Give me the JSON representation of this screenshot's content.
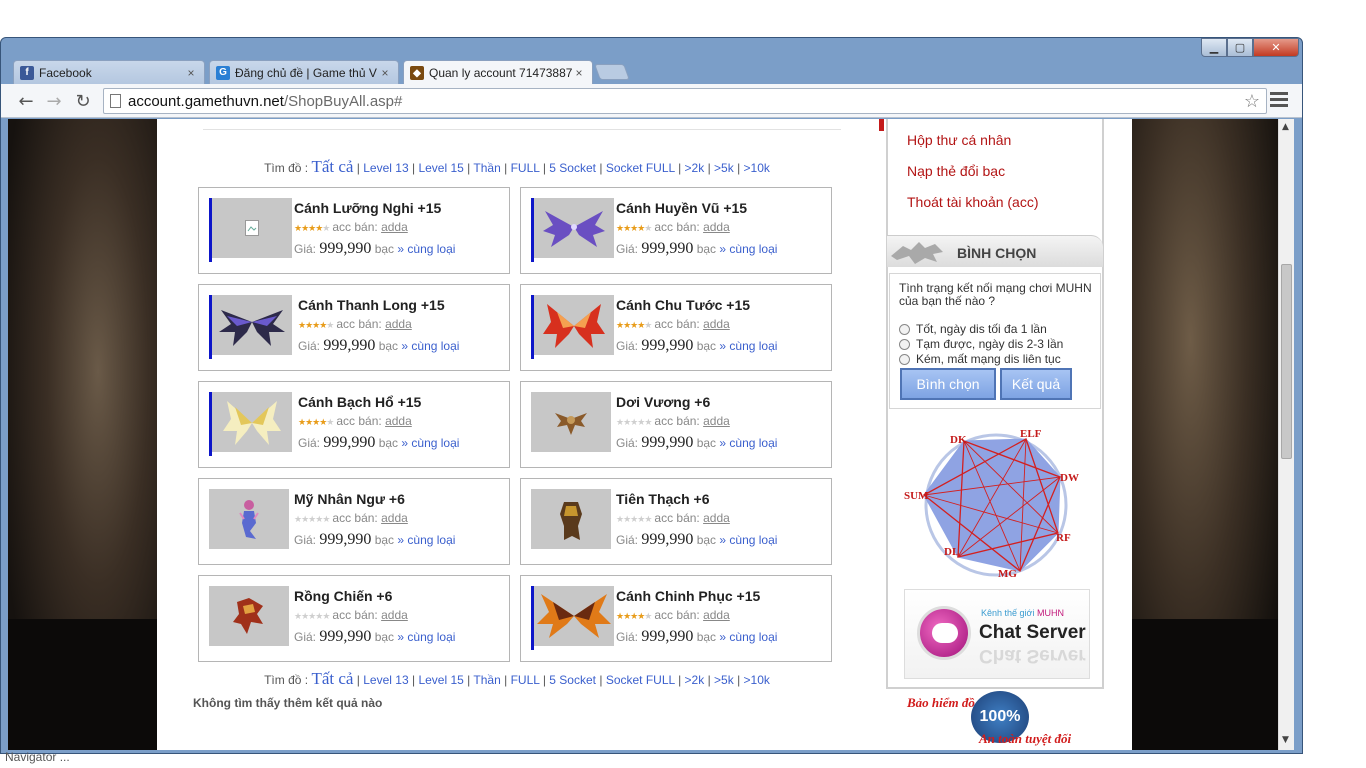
{
  "tabs": [
    {
      "title": "Facebook",
      "favicon": "facebook-icon",
      "close": "×"
    },
    {
      "title": "Đăng chủ đề | Game thủ V",
      "favicon": "gamethu-icon",
      "close": "×"
    },
    {
      "title": "Quan ly account 71473887",
      "favicon": "mu-game-icon",
      "close": "×"
    }
  ],
  "window_controls": {
    "minimize": "▁",
    "maximize": "▢",
    "close": "✕"
  },
  "address": {
    "host": "account.gamethuvn.net",
    "path": "/ShopBuyAll.asp#"
  },
  "filter": {
    "prefix": "Tìm đồ :",
    "all": "Tất cả",
    "links": [
      "Level 13",
      "Level 15",
      "Thần",
      "FULL",
      "5 Socket",
      "Socket FULL",
      ">2k",
      ">5k",
      ">10k"
    ],
    "separator": "|"
  },
  "items": [
    {
      "name": "Cánh Lưỡng Nghi +15",
      "seller_label": "acc bán:",
      "seller": "adda",
      "price_label": "Giá:",
      "price": "999,990",
      "currency": "bạc",
      "same_type": "» cùng loại",
      "rating": 4,
      "icon": "broken-image-icon"
    },
    {
      "name": "Cánh Huyền Vũ +15",
      "seller_label": "acc bán:",
      "seller": "adda",
      "price_label": "Giá:",
      "price": "999,990",
      "currency": "bạc",
      "same_type": "» cùng loại",
      "rating": 4,
      "icon": "purple-wings-icon"
    },
    {
      "name": "Cánh Thanh Long +15",
      "seller_label": "acc bán:",
      "seller": "adda",
      "price_label": "Giá:",
      "price": "999,990",
      "currency": "bạc",
      "same_type": "» cùng loại",
      "rating": 4,
      "icon": "dark-wings-icon"
    },
    {
      "name": "Cánh Chu Tước +15",
      "seller_label": "acc bán:",
      "seller": "adda",
      "price_label": "Giá:",
      "price": "999,990",
      "currency": "bạc",
      "same_type": "» cùng loại",
      "rating": 4,
      "icon": "red-wings-icon"
    },
    {
      "name": "Cánh Bạch Hổ +15",
      "seller_label": "acc bán:",
      "seller": "adda",
      "price_label": "Giá:",
      "price": "999,990",
      "currency": "bạc",
      "same_type": "» cùng loại",
      "rating": 4,
      "icon": "white-wings-icon"
    },
    {
      "name": "Dơi Vương +6",
      "seller_label": "acc bán:",
      "seller": "adda",
      "price_label": "Giá:",
      "price": "999,990",
      "currency": "bạc",
      "same_type": "» cùng loại",
      "rating": 0,
      "icon": "bat-pet-icon"
    },
    {
      "name": "Mỹ Nhân Ngư +6",
      "seller_label": "acc bán:",
      "seller": "adda",
      "price_label": "Giá:",
      "price": "999,990",
      "currency": "bạc",
      "same_type": "» cùng loại",
      "rating": 0,
      "icon": "mermaid-pet-icon"
    },
    {
      "name": "Tiên Thạch +6",
      "seller_label": "acc bán:",
      "seller": "adda",
      "price_label": "Giá:",
      "price": "999,990",
      "currency": "bạc",
      "same_type": "» cùng loại",
      "rating": 0,
      "icon": "golem-pet-icon"
    },
    {
      "name": "Rồng Chiến +6",
      "seller_label": "acc bán:",
      "seller": "adda",
      "price_label": "Giá:",
      "price": "999,990",
      "currency": "bạc",
      "same_type": "» cùng loại",
      "rating": 0,
      "icon": "dragon-pet-icon"
    },
    {
      "name": "Cánh Chinh Phục +15",
      "seller_label": "acc bán:",
      "seller": "adda",
      "price_label": "Giá:",
      "price": "999,990",
      "currency": "bạc",
      "same_type": "» cùng loại",
      "rating": 4,
      "icon": "fire-wings-icon"
    }
  ],
  "no_more": "Không tìm thấy thêm kết quả nào",
  "sidebar": {
    "links": [
      "Hộp thư cá nhân",
      "Nạp thẻ đổi bạc",
      "Thoát tài khoản (acc)"
    ],
    "poll": {
      "title": "BÌNH CHỌN",
      "question": "Tình trạng kết nối mạng chơi MUHN của bạn thế nào ?",
      "options": [
        "Tốt, ngày dis tối đa 1 lần",
        "Tạm được, ngày dis 2-3 lần",
        "Kém, mất mạng dis liên tục"
      ],
      "vote_button": "Bình chọn",
      "result_button": "Kết quả"
    },
    "class_ring": [
      "DK",
      "ELF",
      "DW",
      "RF",
      "MG",
      "DL",
      "SUM"
    ],
    "chat_banner": {
      "subtitle_prefix": "Kênh thế giới",
      "subtitle_brand": "MUHN",
      "title": "Chat Server"
    },
    "insurance": {
      "line1": "Bảo hiểm đồ",
      "seal": "100%",
      "line2": "An toàn tuyệt đối"
    }
  },
  "status": "Navigator ..."
}
